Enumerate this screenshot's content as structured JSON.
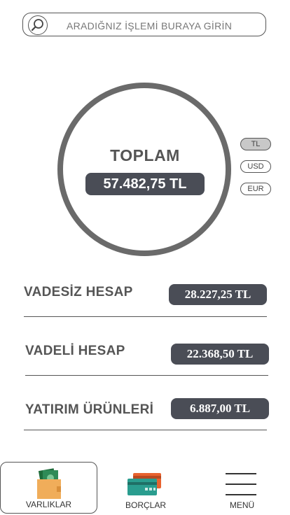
{
  "search": {
    "placeholder": "ARADIĞNIZ İŞLEMİ BURAYA GİRİN",
    "icon": "search-icon"
  },
  "summary": {
    "title": "TOPLAM",
    "amount": "57.482,75 TL"
  },
  "currencies": [
    {
      "label": "TL",
      "selected": true
    },
    {
      "label": "USD",
      "selected": false
    },
    {
      "label": "EUR",
      "selected": false
    }
  ],
  "accounts": [
    {
      "label": "VADESİZ HESAP",
      "value": "28.227,25 TL"
    },
    {
      "label": "VADELİ HESAP",
      "value": "22.368,50 TL"
    },
    {
      "label": "YATIRIM ÜRÜNLERİ",
      "value": "6.887,00 TL"
    }
  ],
  "nav": {
    "tabs": [
      {
        "label": "VARLIKLAR",
        "icon": "wallet-icon",
        "active": true
      },
      {
        "label": "BORÇLAR",
        "icon": "credit-cards-icon",
        "active": false
      },
      {
        "label": "MENÜ",
        "icon": "hamburger-menu-icon",
        "active": false
      }
    ]
  },
  "colors": {
    "pill_bg": "#4a4d56",
    "ring": "#6a6a6a",
    "wallet": "#f0ad5a",
    "money": "#2e8b57",
    "card_back": "#e8632f",
    "card_front": "#2a9d8f"
  }
}
